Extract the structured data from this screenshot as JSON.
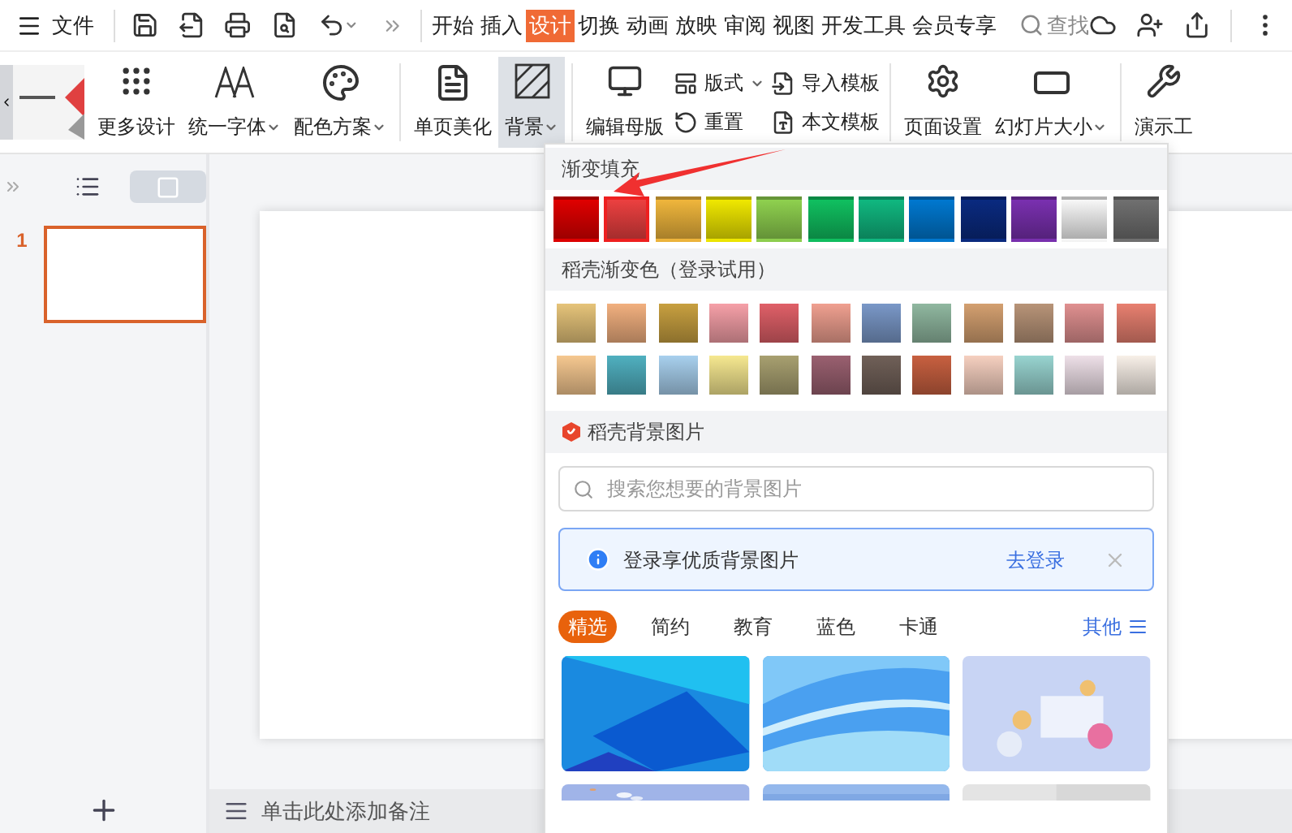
{
  "menu": {
    "label": "文件"
  },
  "tabs": [
    {
      "label": "开始",
      "selected": false
    },
    {
      "label": "插入",
      "selected": false
    },
    {
      "label": "设计",
      "selected": true
    },
    {
      "label": "切换",
      "selected": false
    },
    {
      "label": "动画",
      "selected": false
    },
    {
      "label": "放映",
      "selected": false
    },
    {
      "label": "审阅",
      "selected": false
    },
    {
      "label": "视图",
      "selected": false
    },
    {
      "label": "开发工具",
      "selected": false
    },
    {
      "label": "会员专享",
      "selected": false
    }
  ],
  "search": {
    "label": "查找"
  },
  "ribbon": {
    "more_design": "更多设计",
    "font": "统一字体",
    "color_scheme": "配色方案",
    "page_beautify": "单页美化",
    "background": {
      "label": "背景",
      "active": true
    },
    "edit_master": "编辑母版",
    "layout": "版式",
    "reset": "重置",
    "import_template": "导入模板",
    "text_template": "本文模板",
    "page_setup": "页面设置",
    "slide_size": "幻灯片大小",
    "present_tools": "演示工"
  },
  "slides": [
    {
      "number": "1",
      "selected": true
    }
  ],
  "notes": {
    "placeholder": "单击此处添加备注"
  },
  "background_menu": {
    "gradient_title": "渐变填充",
    "gradients": [
      {
        "color": "#e00000",
        "selected": false
      },
      {
        "color": "#ec4040",
        "selected": true
      },
      {
        "color": "#f0b63c",
        "selected": false
      },
      {
        "color": "#f0e800",
        "selected": false
      },
      {
        "color": "#8fd14f",
        "selected": false
      },
      {
        "color": "#10c060",
        "selected": false
      },
      {
        "color": "#10b880",
        "selected": false
      },
      {
        "color": "#0078d0",
        "selected": false
      },
      {
        "color": "#0a2a80",
        "selected": false
      },
      {
        "color": "#7a30b0",
        "selected": false
      },
      {
        "color": "#f8f8f8",
        "selected": false
      },
      {
        "color": "#707070",
        "selected": false
      }
    ],
    "docer_title": "稻壳渐变色（登录试用）",
    "docer_gradients": [
      {
        "color": "#e6c47a"
      },
      {
        "color": "#f2b07f"
      },
      {
        "color": "#c8a040"
      },
      {
        "color": "#f6a0a8"
      },
      {
        "color": "#e06068"
      },
      {
        "color": "#f0a090"
      },
      {
        "color": "#7a98c8"
      },
      {
        "color": "#90b8a0"
      },
      {
        "color": "#d4a070"
      },
      {
        "color": "#b89478"
      },
      {
        "color": "#e09090"
      },
      {
        "color": "#e88070"
      },
      {
        "color": "#f6c890"
      },
      {
        "color": "#50b0c0"
      },
      {
        "color": "#a8d0ee"
      },
      {
        "color": "#f6e890"
      },
      {
        "color": "#a8a070"
      },
      {
        "color": "#9a6070"
      },
      {
        "color": "#706058"
      },
      {
        "color": "#c86040"
      },
      {
        "color": "#f6d0c0"
      },
      {
        "color": "#98d4d0"
      },
      {
        "color": "#eee0e8"
      },
      {
        "color": "#f8f0e8"
      }
    ],
    "pictures_title": "稻壳背景图片",
    "search": {
      "placeholder": "搜索您想要的背景图片"
    },
    "notice": {
      "text": "登录享优质背景图片",
      "link": "去登录"
    },
    "categories": [
      {
        "label": "精选",
        "selected": true
      },
      {
        "label": "简约",
        "selected": false
      },
      {
        "label": "教育",
        "selected": false
      },
      {
        "label": "蓝色",
        "selected": false
      },
      {
        "label": "卡通",
        "selected": false
      }
    ],
    "more": "其他"
  }
}
